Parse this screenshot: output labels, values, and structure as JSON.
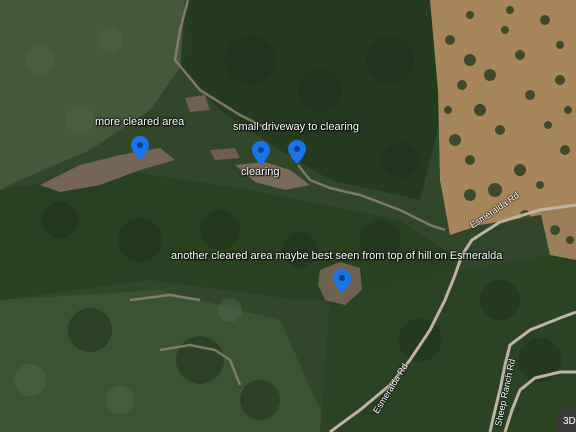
{
  "map": {
    "markers": [
      {
        "label": "more cleared area"
      },
      {
        "label": "small driveway to clearing"
      },
      {
        "label": "clearing"
      },
      {
        "label": "another cleared area maybe best seen from top of hill on Esmeralda"
      }
    ],
    "roads": [
      "Esmeralda Rd",
      "Esmeralda Rd",
      "Sheep Ranch Rd"
    ],
    "view_toggle": "3D",
    "colors": {
      "marker": "#1a73e8",
      "marker_dot": "#0d3f8a",
      "forest": "#2f4a26",
      "dry_grass": "#9a7c55",
      "road": "#b5a99a"
    }
  }
}
